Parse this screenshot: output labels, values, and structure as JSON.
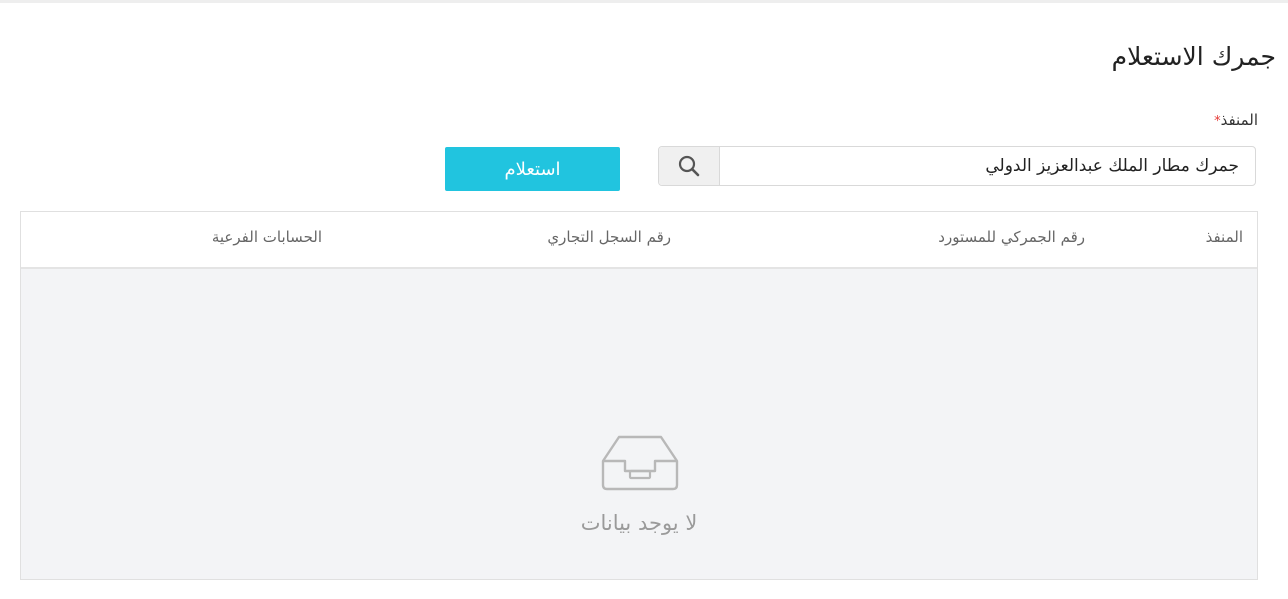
{
  "page": {
    "title": "جمرك الاستعلام"
  },
  "form": {
    "port_label": "المنفذ",
    "required_mark": "*",
    "port_value": "جمرك مطار الملك عبدالعزيز الدولي",
    "inquiry_button": "استعلام"
  },
  "table": {
    "columns": [
      "المنفذ",
      "رقم الجمركي للمستورد",
      "رقم السجل التجاري",
      "الحسابات الفرعية"
    ],
    "empty_text": "لا يوجد بيانات"
  },
  "icons": {
    "search": "search-icon",
    "empty": "empty-inbox-icon"
  },
  "colors": {
    "accent": "#21c4df",
    "required": "#e53935",
    "empty_bg": "#f3f4f6"
  }
}
